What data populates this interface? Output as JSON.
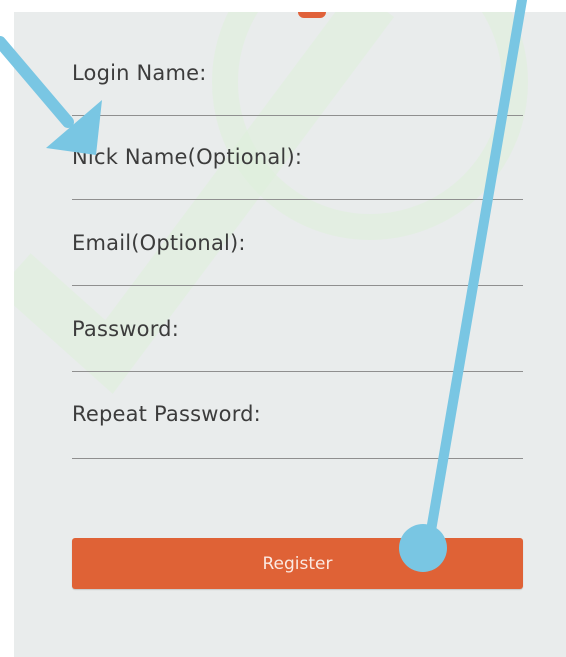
{
  "form": {
    "fields": [
      {
        "label": "Login Name:",
        "value": ""
      },
      {
        "label": "Nick Name(Optional):",
        "value": ""
      },
      {
        "label": "Email(Optional):",
        "value": ""
      },
      {
        "label": "Password:",
        "value": ""
      },
      {
        "label": "Repeat Password:",
        "value": ""
      }
    ],
    "register_label": "Register"
  },
  "colors": {
    "accent": "#df6236",
    "panel_background": "#e9ecec",
    "watermark": "#dff0db",
    "annotation_arrow": "#79c6e3"
  },
  "annotations": {
    "arrow_icon": "arrow-pointer-icon",
    "callout_icon": "callout-pointer-icon"
  }
}
